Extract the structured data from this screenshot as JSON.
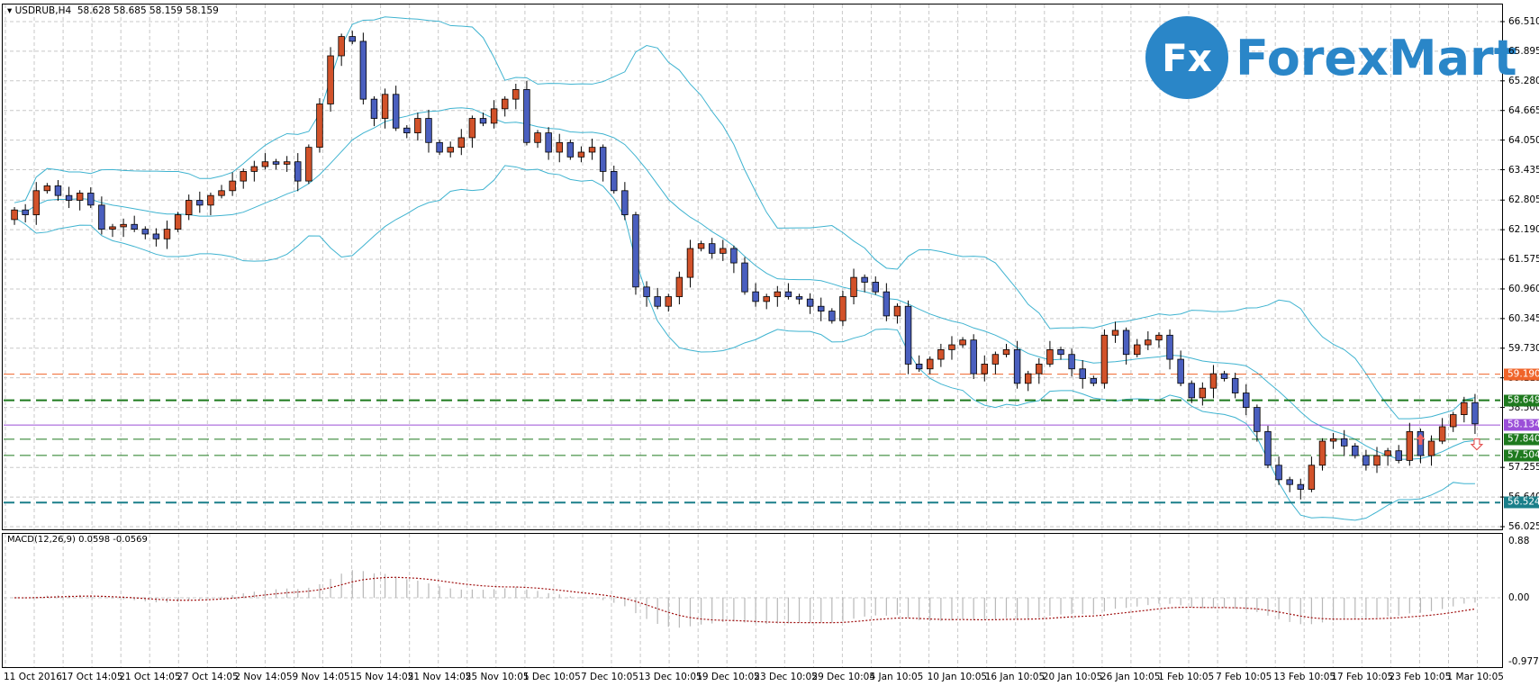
{
  "header": {
    "symbol": "USDRUB,H4",
    "ohlc": "58.628 58.685 58.159 58.159"
  },
  "logo": {
    "mark": "Fx",
    "text": "ForexMart",
    "color": "#2a86c8"
  },
  "macd_label": "MACD(12,26,9) 0.0598 -0.0569",
  "chart_data": {
    "type": "candlestick",
    "symbol": "USDRUB",
    "timeframe": "H4",
    "ylim": [
      56.025,
      66.51
    ],
    "price_ticks": [
      "66.510",
      "65.895",
      "65.280",
      "64.665",
      "64.050",
      "63.435",
      "62.805",
      "62.190",
      "61.575",
      "60.960",
      "60.345",
      "59.730",
      "59.115",
      "58.500",
      "57.255",
      "56.640",
      "56.025"
    ],
    "time_labels": [
      "11 Oct 2016",
      "17 Oct 14:05",
      "21 Oct 14:05",
      "27 Oct 14:05",
      "2 Nov 14:05",
      "9 Nov 14:05",
      "15 Nov 14:05",
      "21 Nov 14:05",
      "25 Nov 10:05",
      "1 Dec 10:05",
      "7 Dec 10:05",
      "13 Dec 10:05",
      "19 Dec 10:05",
      "23 Dec 10:05",
      "29 Dec 10:05",
      "4 Jan 10:05",
      "10 Jan 10:05",
      "16 Jan 10:05",
      "20 Jan 10:05",
      "26 Jan 10:05",
      "1 Feb 10:05",
      "7 Feb 10:05",
      "13 Feb 10:05",
      "17 Feb 10:05",
      "23 Feb 10:05",
      "1 Mar 10:05"
    ],
    "first_open": 62.4,
    "closes": [
      62.6,
      62.5,
      63.0,
      63.1,
      62.9,
      62.8,
      62.95,
      62.7,
      62.2,
      62.25,
      62.3,
      62.2,
      62.1,
      62.0,
      62.2,
      62.5,
      62.8,
      62.7,
      62.9,
      63.0,
      63.2,
      63.4,
      63.5,
      63.6,
      63.55,
      63.6,
      63.2,
      63.9,
      64.8,
      65.8,
      66.2,
      66.1,
      64.9,
      64.5,
      65.0,
      64.3,
      64.2,
      64.5,
      64.0,
      63.8,
      63.9,
      64.1,
      64.5,
      64.4,
      64.7,
      64.9,
      65.1,
      64.0,
      64.2,
      63.8,
      64.0,
      63.7,
      63.8,
      63.9,
      63.4,
      63.0,
      62.5,
      61.0,
      60.8,
      60.6,
      60.8,
      61.2,
      61.8,
      61.9,
      61.7,
      61.8,
      61.5,
      60.9,
      60.7,
      60.8,
      60.9,
      60.8,
      60.75,
      60.6,
      60.5,
      60.3,
      60.8,
      61.2,
      61.1,
      60.9,
      60.4,
      60.6,
      59.4,
      59.3,
      59.5,
      59.7,
      59.8,
      59.9,
      59.2,
      59.4,
      59.6,
      59.7,
      59.0,
      59.2,
      59.4,
      59.7,
      59.6,
      59.3,
      59.1,
      59.0,
      60.0,
      60.1,
      59.6,
      59.8,
      59.9,
      60.0,
      59.5,
      59.0,
      58.7,
      58.9,
      59.2,
      59.1,
      58.8,
      58.5,
      58.0,
      57.3,
      57.0,
      56.9,
      56.8,
      57.3,
      57.8,
      57.85,
      57.7,
      57.5,
      57.3,
      57.5,
      57.6,
      57.4,
      58.0,
      57.5,
      57.8,
      58.1,
      58.35,
      58.6,
      58.159
    ],
    "levels": [
      {
        "value": "59.190",
        "color": "#f0642a",
        "style": "dashed"
      },
      {
        "value": "58.649",
        "color": "#1e7a1e",
        "style": "dashed-bold"
      },
      {
        "value": "58.134",
        "color": "#9b4fd8",
        "style": "solid"
      },
      {
        "value": "57.840",
        "color": "#1e7a1e",
        "style": "dashed"
      },
      {
        "value": "57.504",
        "color": "#1e7a1e",
        "style": "dashed"
      },
      {
        "value": "56.524",
        "color": "#1a7f8a",
        "style": "dashed-bold"
      }
    ],
    "bull_color": "#d2522a",
    "bear_color": "#4a5fbf",
    "band_color": "#3fb3d0",
    "macd": {
      "ticks": [
        "0.88",
        "0.00",
        "-0.9773"
      ],
      "ylim": [
        -0.9773,
        0.88
      ],
      "signal_color": "#a01010",
      "hist_color": "#b8b8b8"
    }
  }
}
